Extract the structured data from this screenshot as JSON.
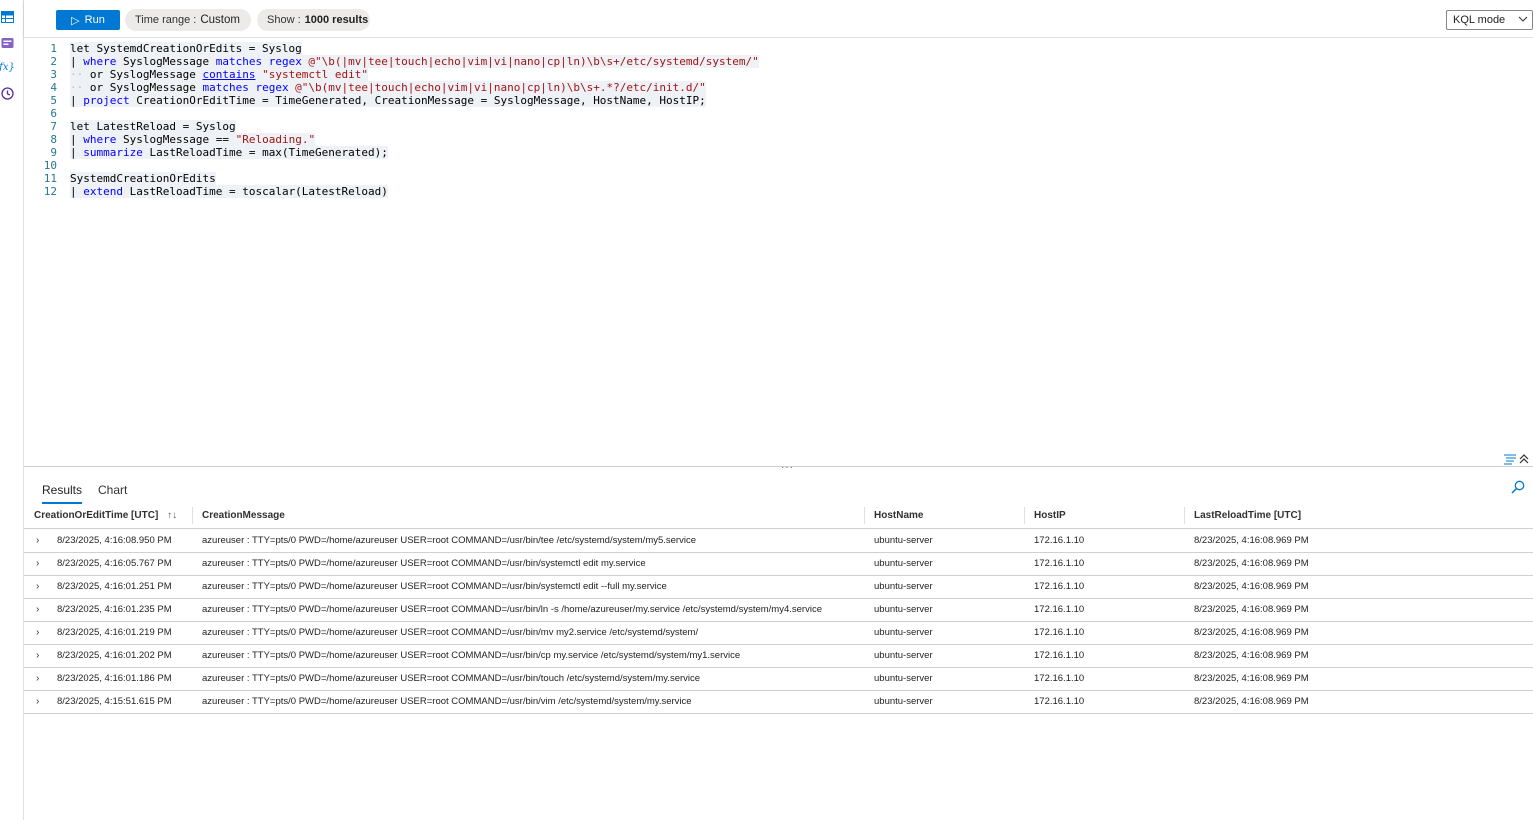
{
  "toolbar": {
    "run_label": "Run",
    "time_range_label": "Time range :",
    "time_range_value": "Custom",
    "show_label": "Show :",
    "show_value": "1000 results",
    "mode_value": "KQL mode"
  },
  "editor": {
    "lines": [
      {
        "num": "1"
      },
      {
        "num": "2"
      },
      {
        "num": "3"
      },
      {
        "num": "4"
      },
      {
        "num": "5"
      },
      {
        "num": "6"
      },
      {
        "num": "7"
      },
      {
        "num": "8"
      },
      {
        "num": "9"
      },
      {
        "num": "10"
      },
      {
        "num": "11"
      },
      {
        "num": "12"
      }
    ],
    "code": {
      "l1_a": "let SystemdCreationOrEdits = Syslog",
      "l2_a": "| ",
      "l2_kw": "where",
      "l2_b": " SyslogMessage ",
      "l2_kw2": "matches regex",
      "l2_str": " @\"\\b(|mv|tee|touch|echo|vim|vi|nano|cp|ln)\\b\\s+/etc/systemd/system/\"",
      "l3_ws": "··",
      "l3_a": " or SyslogMessage ",
      "l3_kw": "contains",
      "l3_str": " \"systemctl edit\"",
      "l4_ws": "··",
      "l4_a": " or SyslogMessage ",
      "l4_kw": "matches regex",
      "l4_str": " @\"\\b(mv|tee|touch|echo|vim|vi|nano|cp|ln)\\b\\s+.*?/etc/init.d/\"",
      "l5_a": "| ",
      "l5_kw": "project",
      "l5_b": " CreationOrEditTime = TimeGenerated, CreationMessage = SyslogMessage, HostName, HostIP;",
      "l7_a": "let LatestReload = Syslog",
      "l8_a": "| ",
      "l8_kw": "where",
      "l8_b": " SyslogMessage == ",
      "l8_str": "\"Reloading.\"",
      "l9_a": "| ",
      "l9_kw": "summarize",
      "l9_b": " LastReloadTime = max(TimeGenerated);",
      "l11_a": "SystemdCreationOrEdits",
      "l12_a": "| ",
      "l12_kw": "extend",
      "l12_b": " LastReloadTime = toscalar(LatestReload)"
    }
  },
  "results": {
    "tabs": [
      "Results",
      "Chart"
    ],
    "columns": [
      "CreationOrEditTime [UTC]",
      "CreationMessage",
      "HostName",
      "HostIP",
      "LastReloadTime [UTC]"
    ],
    "rows": [
      {
        "time": "8/23/2025, 4:16:08.950 PM",
        "msg": "azureuser : TTY=pts/0 PWD=/home/azureuser USER=root COMMAND=/usr/bin/tee /etc/systemd/system/my5.service",
        "host": "ubuntu-server",
        "ip": "172.16.1.10",
        "reload": "8/23/2025, 4:16:08.969 PM"
      },
      {
        "time": "8/23/2025, 4:16:05.767 PM",
        "msg": "azureuser : TTY=pts/0 PWD=/home/azureuser USER=root COMMAND=/usr/bin/systemctl edit my.service",
        "host": "ubuntu-server",
        "ip": "172.16.1.10",
        "reload": "8/23/2025, 4:16:08.969 PM"
      },
      {
        "time": "8/23/2025, 4:16:01.251 PM",
        "msg": "azureuser : TTY=pts/0 PWD=/home/azureuser USER=root COMMAND=/usr/bin/systemctl edit --full my.service",
        "host": "ubuntu-server",
        "ip": "172.16.1.10",
        "reload": "8/23/2025, 4:16:08.969 PM"
      },
      {
        "time": "8/23/2025, 4:16:01.235 PM",
        "msg": "azureuser : TTY=pts/0 PWD=/home/azureuser USER=root COMMAND=/usr/bin/ln -s /home/azureuser/my.service /etc/systemd/system/my4.service",
        "host": "ubuntu-server",
        "ip": "172.16.1.10",
        "reload": "8/23/2025, 4:16:08.969 PM"
      },
      {
        "time": "8/23/2025, 4:16:01.219 PM",
        "msg": "azureuser : TTY=pts/0 PWD=/home/azureuser USER=root COMMAND=/usr/bin/mv my2.service /etc/systemd/system/",
        "host": "ubuntu-server",
        "ip": "172.16.1.10",
        "reload": "8/23/2025, 4:16:08.969 PM"
      },
      {
        "time": "8/23/2025, 4:16:01.202 PM",
        "msg": "azureuser : TTY=pts/0 PWD=/home/azureuser USER=root COMMAND=/usr/bin/cp my.service /etc/systemd/system/my1.service",
        "host": "ubuntu-server",
        "ip": "172.16.1.10",
        "reload": "8/23/2025, 4:16:08.969 PM"
      },
      {
        "time": "8/23/2025, 4:16:01.186 PM",
        "msg": "azureuser : TTY=pts/0 PWD=/home/azureuser USER=root COMMAND=/usr/bin/touch /etc/systemd/system/my.service",
        "host": "ubuntu-server",
        "ip": "172.16.1.10",
        "reload": "8/23/2025, 4:16:08.969 PM"
      },
      {
        "time": "8/23/2025, 4:15:51.615 PM",
        "msg": "azureuser : TTY=pts/0 PWD=/home/azureuser USER=root COMMAND=/usr/bin/vim /etc/systemd/system/my.service",
        "host": "ubuntu-server",
        "ip": "172.16.1.10",
        "reload": "8/23/2025, 4:16:08.969 PM"
      }
    ]
  },
  "icons": {
    "sidebar": [
      "tables-icon",
      "queries-icon",
      "functions-icon",
      "history-icon"
    ],
    "sidebar_functions_glyph": "fx",
    "expand_glyph": "›",
    "grip_glyph": "···",
    "sort_glyph": "↑↓",
    "run_glyph": "▷"
  },
  "colors": {
    "accent": "#0078d4",
    "keyword": "#0000ff",
    "string": "#a31515",
    "line_number": "#237893"
  }
}
